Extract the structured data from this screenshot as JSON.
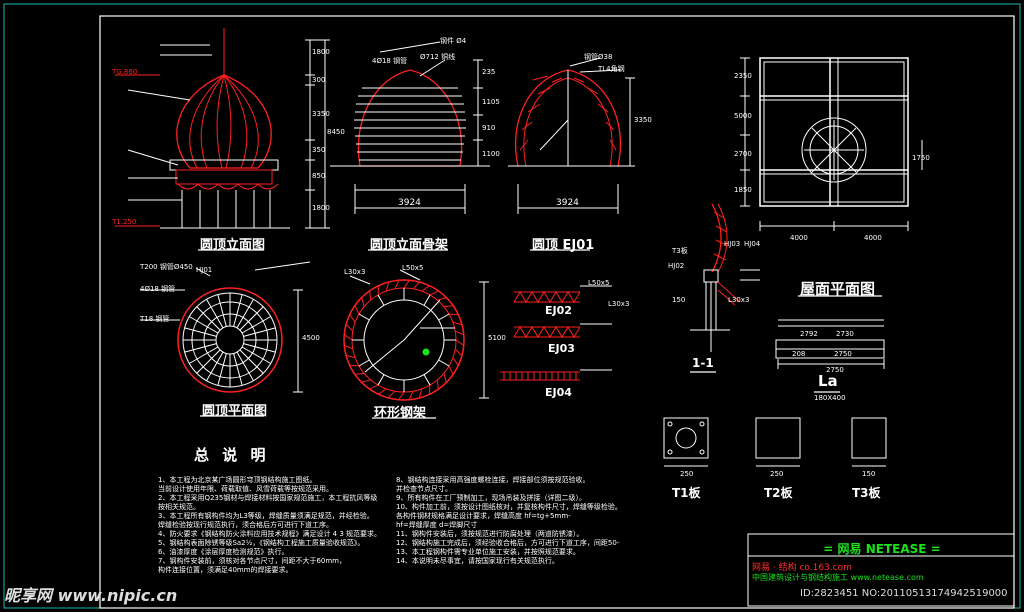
{
  "colors": {
    "line": "#ffffff",
    "red": "#ff2020",
    "cyan": "#18b8b8",
    "green": "#19e219",
    "bg": "#000000"
  },
  "titles": {
    "dome_elev": "圆顶立面图",
    "dome_frame": "圆顶立面骨架",
    "dome_ej01": "圆顶 EJ01",
    "roof_plan": "屋面平面图",
    "dome_plan": "圆顶平面图",
    "ring_truss": "环形钢架",
    "ej02": "EJ02",
    "ej03": "EJ03",
    "ej04": "EJ04",
    "sec11": "1-1",
    "la": "La",
    "la_sub": "180X400",
    "t1": "T1板",
    "t2": "T2板",
    "t3": "T3板",
    "notes_title": "总 说 明"
  },
  "dims": {
    "elev_right": [
      "1800",
      "300",
      "3350",
      "350",
      "850",
      "1800"
    ],
    "elev_total": "8450",
    "frame_right": [
      "235",
      "1105",
      "910",
      "1100"
    ],
    "frame_bottom": "3924",
    "ej01_right": "3350",
    "ej01_bottom": "3924",
    "plan_side": "4500",
    "ring_side": "5100",
    "roof_left": [
      "2350",
      "5000",
      "2700",
      "1850"
    ],
    "roof_right": "1750",
    "roof_bottom": [
      "4000",
      "4000"
    ],
    "la_dims": [
      "2792",
      "2730",
      "208",
      "2750",
      "2750"
    ],
    "t_dims": [
      "250",
      "250",
      "150"
    ]
  },
  "labels": {
    "frame_top1": "4Ø18 钢管",
    "frame_top2": "Ø712 铜线",
    "frame_top3": "钢件 Ø4",
    "ej01_top1": "钢管Ø38",
    "ej01_top2": "TL4角钢",
    "plan_top1": "T200 钢管Ø450",
    "plan_top2": "HJ01",
    "plan_top3": "4Ø18 钢管",
    "plan_top4": "T18 钢管",
    "ring_l1": "L30x3",
    "ring_l2": "L50x5",
    "ej_l1": "L50x5",
    "ej_l2": "L30x3",
    "sec_t3": "T3板",
    "sec_hj02": "HJ02",
    "sec_hj03": "HJ03",
    "sec_hj04": "HJ04",
    "sec_m": "150",
    "sec_l": "L30x3",
    "elev_red1": "TG.860",
    "elev_red2": "T1.250"
  },
  "notes_left": [
    "1、本工程为北京某广场圆形穹顶钢结构施工图纸。",
    "   当前设计使用年限、荷载取值、风雪荷载等按规范采用。",
    "2、本工程采用Q235钢材与焊接材料按国家规范施工，本工程抗风等级",
    "   按相关规范。",
    "3、本工程所有钢构件均为L3等级，焊缝质量须满足规范，并经检验。",
    "   焊缝检验按现行规范执行，须合格后方可进行下道工序。",
    "4、防火要求《钢结构防火涂料应用技术规程》满足设计 4 3 规范要求。",
    "5、钢结构表面除锈等级Sa2½，《钢结构工程施工质量验收规范》。",
    "6、油漆厚度《涂层厚度检测规范》执行。",
    "7、钢构件安装前，须核对各节点尺寸，间距不大于60mm，",
    "   构件连接位置，须满足40mm的焊接要求。"
  ],
  "notes_right": [
    "8、钢结构连接采用高强度螺栓连接，焊接部位须按规范验收。",
    "   并检查节点尺寸。",
    "9、所有构件在工厂预制加工，现场吊装及拼接（详图二级）。",
    "10、构件加工前，须按设计图纸核对，并复核构件尺寸，焊缝等级检验。",
    "   各构件钢材规格满足设计要求，焊缝高度 hf=tg+5mm-",
    "   hf=焊缝厚度 d=焊脚尺寸",
    "11、钢构件安装后，须按规范进行防腐处理（两道防锈漆）。",
    "12、钢结构施工完成后，须经验收合格后，方可进行下道工序，间距50-",
    "13、本工程钢构件需专业单位施工安装，并按照规范要求。",
    "14、本说明未尽事宜，请按国家现行有关规范执行。"
  ],
  "title_block": {
    "head": "= 网易 NETEASE =",
    "sub": "网易 · 结构  co.163.com",
    "sub2": "中国建筑设计与钢结构施工  www.netease.com"
  },
  "watermark": {
    "left": "昵享网 www.nipic.cn",
    "right": "ID:2823451 NO:20110513174942519000"
  }
}
